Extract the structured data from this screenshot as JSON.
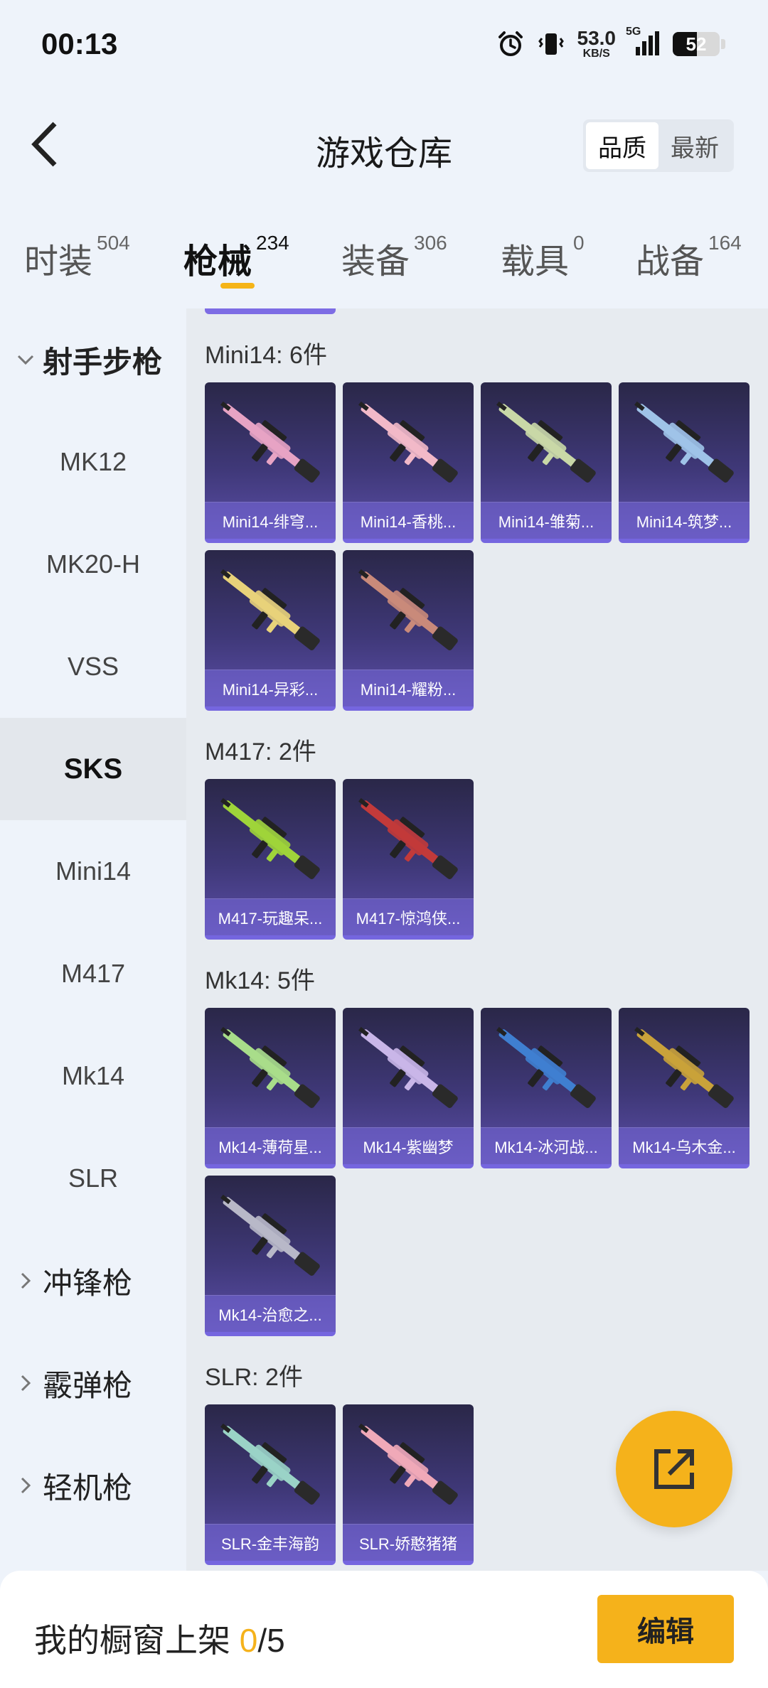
{
  "status_bar": {
    "time": "00:13",
    "net_speed": "53.0",
    "net_unit": "KB/S",
    "network": "5G",
    "battery": "52",
    "battery_level": 0.52,
    "icons": [
      "alarm-icon",
      "vibrate-icon",
      "signal-icon",
      "battery-icon"
    ]
  },
  "header": {
    "title": "游戏仓库",
    "back_icon": "chevron-left-icon",
    "sort_options": [
      {
        "label": "品质",
        "active": true
      },
      {
        "label": "最新",
        "active": false
      }
    ]
  },
  "tabs": [
    {
      "label": "时装",
      "count": "504",
      "active": false
    },
    {
      "label": "枪械",
      "count": "234",
      "active": true
    },
    {
      "label": "装备",
      "count": "306",
      "active": false
    },
    {
      "label": "载具",
      "count": "0",
      "active": false
    },
    {
      "label": "战备",
      "count": "164",
      "active": false
    }
  ],
  "sidebar": {
    "groups": [
      {
        "label": "射手步枪",
        "expanded": true
      },
      {
        "label": "冲锋枪",
        "expanded": false
      },
      {
        "label": "霰弹枪",
        "expanded": false
      },
      {
        "label": "轻机枪",
        "expanded": false
      }
    ],
    "items": [
      {
        "label": "MK12",
        "selected": false
      },
      {
        "label": "MK20-H",
        "selected": false
      },
      {
        "label": "VSS",
        "selected": false
      },
      {
        "label": "SKS",
        "selected": true
      },
      {
        "label": "Mini14",
        "selected": false
      },
      {
        "label": "M417",
        "selected": false
      },
      {
        "label": "Mk14",
        "selected": false
      },
      {
        "label": "SLR",
        "selected": false
      }
    ]
  },
  "sections": [
    {
      "title": "Mini14: 6件",
      "items": [
        {
          "name": "Mini14-绯穹...",
          "color": "#e7a3c4"
        },
        {
          "name": "Mini14-香桃...",
          "color": "#f2b9c8"
        },
        {
          "name": "Mini14-雏菊...",
          "color": "#c9d8a7"
        },
        {
          "name": "Mini14-筑梦...",
          "color": "#9fc3e8"
        },
        {
          "name": "Mini14-异彩...",
          "color": "#e8d27a"
        },
        {
          "name": "Mini14-耀粉...",
          "color": "#c98a7a"
        }
      ]
    },
    {
      "title": "M417: 2件",
      "items": [
        {
          "name": "M417-玩趣呆...",
          "color": "#9fd43a"
        },
        {
          "name": "M417-惊鸿侠...",
          "color": "#c23a3a"
        }
      ]
    },
    {
      "title": "Mk14: 5件",
      "items": [
        {
          "name": "Mk14-薄荷星...",
          "color": "#a8dd8a"
        },
        {
          "name": "Mk14-紫幽梦",
          "color": "#c9b6e8"
        },
        {
          "name": "Mk14-冰河战...",
          "color": "#3f7fd0"
        },
        {
          "name": "Mk14-乌木金...",
          "color": "#c9a23a"
        },
        {
          "name": "Mk14-治愈之...",
          "color": "#b8b8c8"
        }
      ]
    },
    {
      "title": "SLR: 2件",
      "items": [
        {
          "name": "SLR-金丰海韵",
          "color": "#9ad3c6"
        },
        {
          "name": "SLR-娇憨猪猪",
          "color": "#f0a9b8"
        }
      ]
    }
  ],
  "bottom_bar": {
    "label": "我的橱窗上架 ",
    "count": "0",
    "total": "/5",
    "edit_label": "编辑"
  },
  "fab_icon": "share-external-icon",
  "colors": {
    "accent": "#f5b21b",
    "card_border": "#7566df",
    "background": "#eef3fa"
  }
}
